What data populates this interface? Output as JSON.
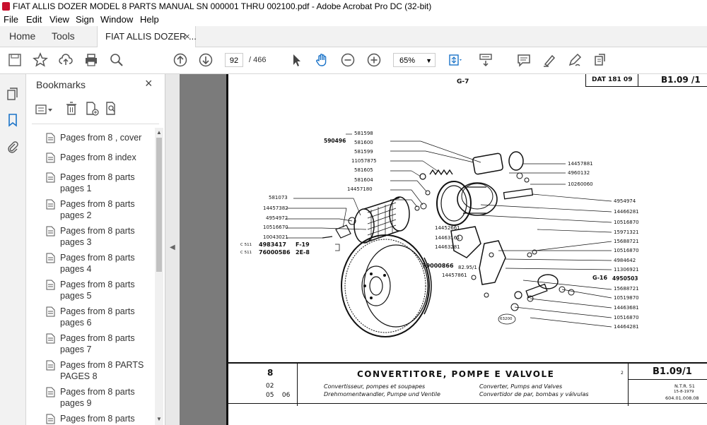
{
  "window": {
    "title": "FIAT ALLIS DOZER MODEL 8 PARTS MANUAL SN 000001 THRU 002100.pdf - Adobe Acrobat Pro DC (32-bit)"
  },
  "menu": [
    "File",
    "Edit",
    "View",
    "Sign",
    "Window",
    "Help"
  ],
  "tabs": {
    "home": "Home",
    "tools": "Tools",
    "document": "FIAT ALLIS DOZER ...",
    "close": "×"
  },
  "toolbar": {
    "page_current": "92",
    "page_total": "/ 466",
    "zoom": "65%"
  },
  "bookmarks": {
    "header": "Bookmarks",
    "close": "×",
    "items": [
      {
        "label": "Pages from 8 , cover"
      },
      {
        "label": "Pages from 8 index"
      },
      {
        "label": "Pages from 8 parts pages 1"
      },
      {
        "label": "Pages from 8 parts pages 2"
      },
      {
        "label": "Pages from 8 parts pages 3"
      },
      {
        "label": "Pages from 8 parts pages 4"
      },
      {
        "label": "Pages from 8 parts pages 5"
      },
      {
        "label": "Pages from 8 parts pages 6"
      },
      {
        "label": "Pages from 8 parts pages 7"
      },
      {
        "label": "Pages from 8 PARTS PAGES 8"
      },
      {
        "label": "Pages from 8 parts pages 9"
      },
      {
        "label": "Pages from 8 parts"
      }
    ]
  },
  "page": {
    "top_code": "G-7",
    "dat": "DAT 181 09",
    "ref_top": "B1.09 /1",
    "ref_bottom": "B1.09/1",
    "title": "CONVERTITORE, POMPE E VALVOLE",
    "sub_fr": "Convertisseur, pompes et soupapes",
    "sub_de": "Drehmomentwandler, Pumpe und Ventile",
    "sub_en": "Converter, Pumps and Valves",
    "sub_es": "Convertidor de par, bombas y válvulas",
    "model": "8",
    "codes_a": "02",
    "codes_b": "05    06",
    "ntr": "N.T.R. 51",
    "date": "15-8-1979",
    "docnum": "604.01.008.08",
    "small_2": "2",
    "circle_label": "63200",
    "g16": "G-16",
    "f19": "F-19",
    "e28": "2E-8",
    "c511a": "C 511",
    "c511b": "C 511",
    "left_parts": [
      "590496",
      "581598",
      "581600",
      "581599",
      "11057875",
      "581605",
      "581604",
      "14457180",
      "581073",
      "14457382",
      "4954972",
      "10516670",
      "10043021",
      "4983417",
      "76000586"
    ],
    "right_parts": [
      "14457881",
      "4960132",
      "10260060",
      "4954974",
      "14466281",
      "10516870",
      "15971321",
      "15688721",
      "10516870",
      "4984642",
      "11306921",
      "4950503",
      "15688721",
      "10519870",
      "14463681",
      "10516870",
      "14464281"
    ],
    "mid_parts": [
      "14452661",
      "14463161",
      "14463281",
      "79000866",
      "82.95/1",
      "14457861"
    ]
  }
}
